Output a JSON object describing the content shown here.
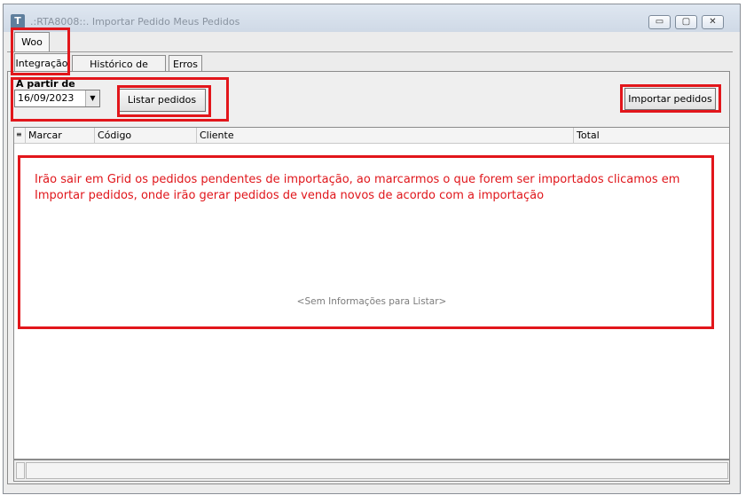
{
  "window": {
    "title": ".:RTA8008::. Importar Pedido Meus Pedidos",
    "controls": [
      "minimize",
      "maximize",
      "close"
    ],
    "minimize_glyph": "▭",
    "maximize_glyph": "▢",
    "close_glyph": "✕",
    "app_icon_glyph": "T"
  },
  "outer_tabs": [
    {
      "label": "Woo"
    }
  ],
  "inner_tabs": [
    {
      "label": "Integração"
    },
    {
      "label": "Histórico de pedidos"
    },
    {
      "label": "Erros"
    }
  ],
  "filters": {
    "date_label": "A partir de",
    "date_value": "16/09/2023",
    "dropdown_glyph": "▼"
  },
  "buttons": {
    "list_orders": "Listar pedidos",
    "import_orders": "Importar pedidos"
  },
  "grid": {
    "columns": [
      "Marcar",
      "Código",
      "Cliente",
      "Total"
    ],
    "empty_message": "<Sem Informações para Listar>",
    "row_marker_glyph": "≡"
  },
  "annotation": {
    "note": "Irão sair em Grid os pedidos pendentes de importação, ao marcarmos o que forem ser importados clicamos em Importar pedidos, onde irão gerar pedidos de venda novos de acordo com a importação",
    "color": "#e2161b"
  }
}
